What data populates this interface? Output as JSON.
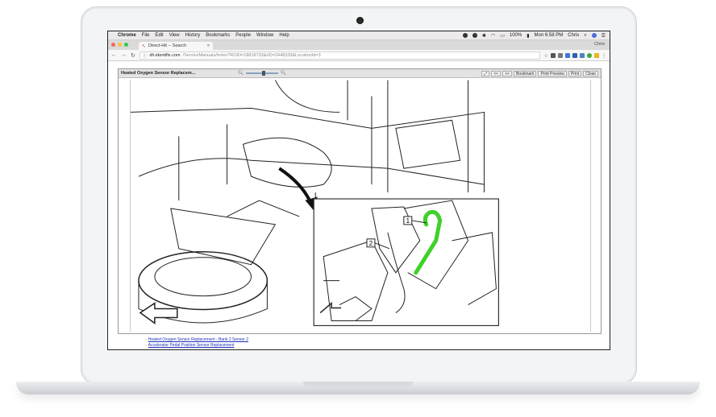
{
  "menubar": {
    "app_name": "Chrome",
    "items": [
      "File",
      "Edit",
      "View",
      "History",
      "Bookmarks",
      "People",
      "Window",
      "Help"
    ],
    "battery": "100%",
    "clock": "Mon 6:58 PM",
    "user": "Chris"
  },
  "browser": {
    "tab_title": "Direct-Hit -- Search",
    "profile": "Chris",
    "url_host": "dh.identifix.com",
    "url_path": "/ServiceManuals/Index?ROID=18818733&rID=2448329&LocationId=3"
  },
  "viewer": {
    "title": "Heated Oxygen Sensor Replacem...",
    "buttons": [
      "Bookmark",
      "Print Preview",
      "Print",
      "Close"
    ],
    "callouts": [
      "1",
      "2"
    ]
  },
  "links": [
    "Heated Oxygen Sensor Replacement - Bank 2 Sensor 2",
    "Accelerator Pedal Position Sensor Replacement"
  ],
  "colors": {
    "highlight": "#3fd12a",
    "link": "#1d2fb8"
  }
}
